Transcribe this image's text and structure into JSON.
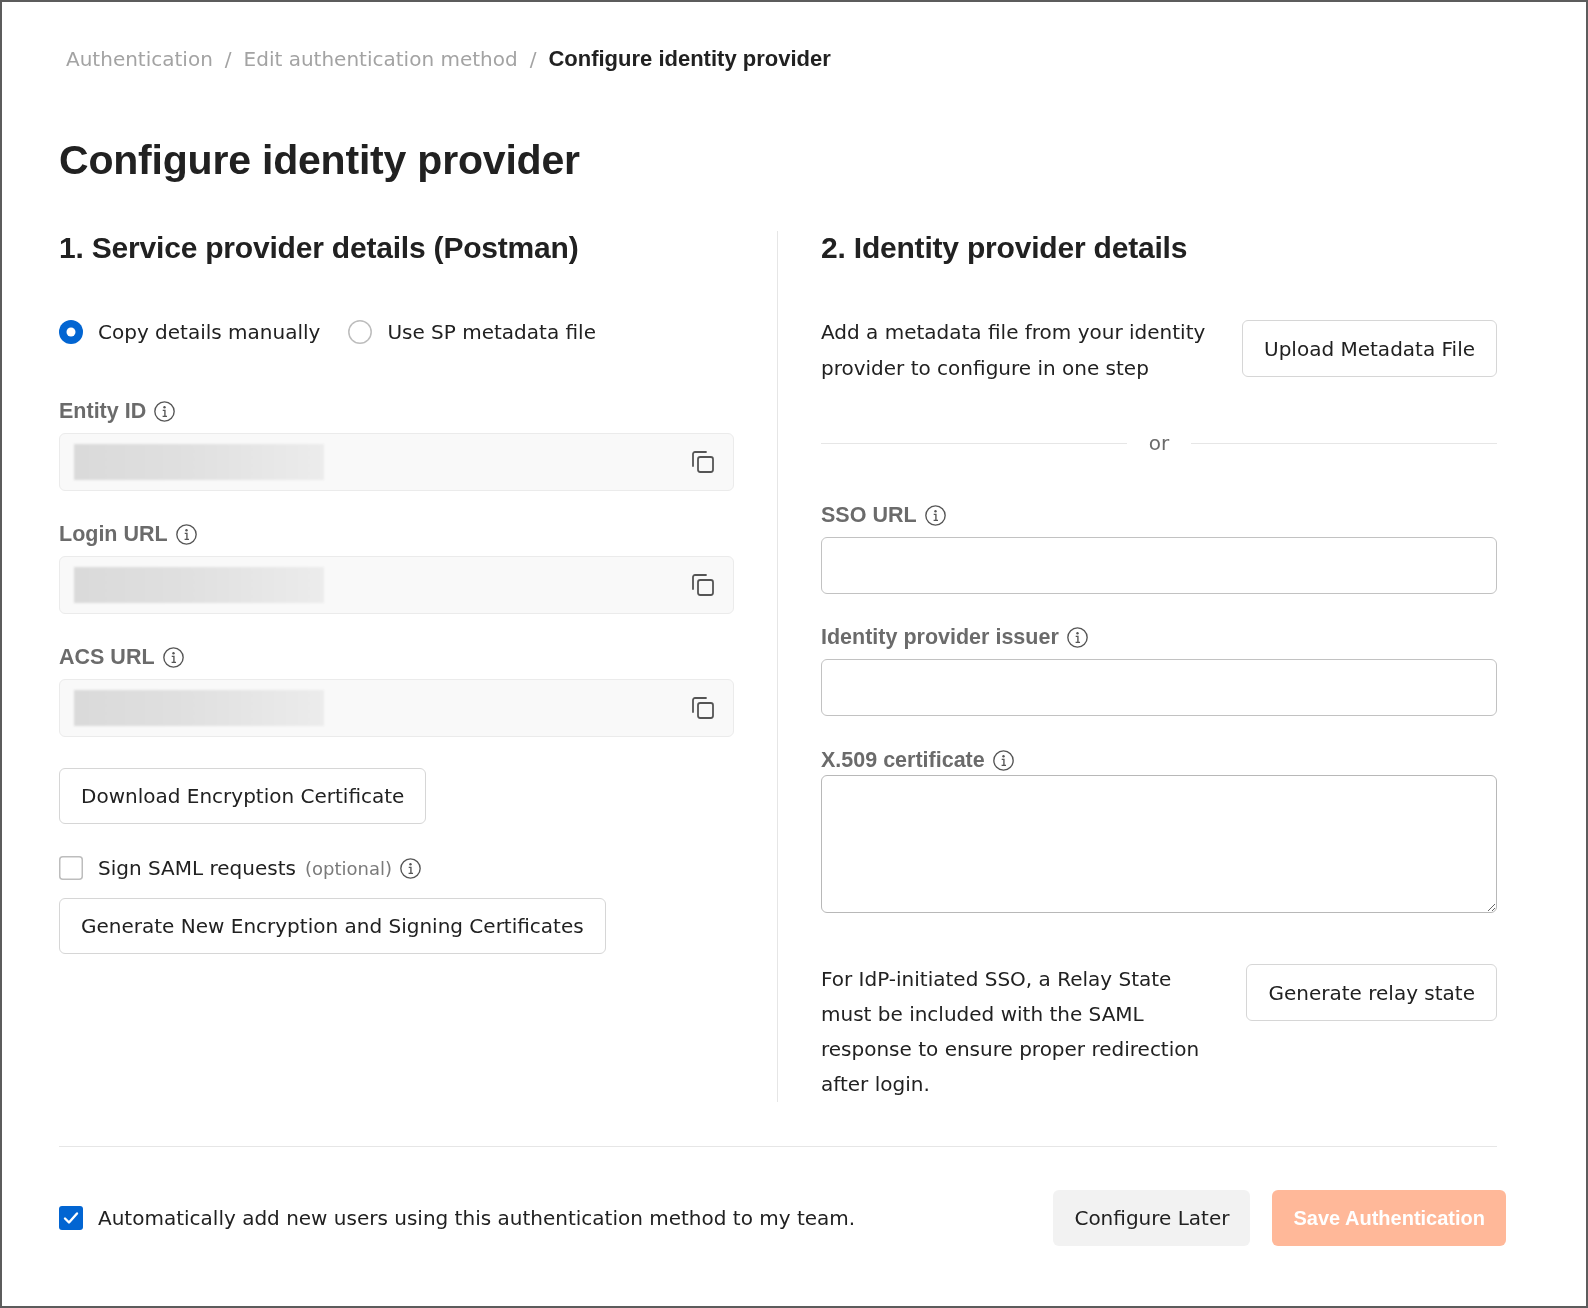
{
  "breadcrumb": [
    {
      "kind": "link",
      "text": "Authentication"
    },
    {
      "kind": "separator",
      "text": "/"
    },
    {
      "kind": "link",
      "text": "Edit authentication method"
    },
    {
      "kind": "separator",
      "text": "/"
    },
    {
      "kind": "current",
      "text": "Configure identity provider"
    }
  ],
  "page_title": "Configure identity provider",
  "service_provider": {
    "heading": "1. Service provider details (Postman)",
    "modes": [
      {
        "label": "Copy details manually",
        "selected": true
      },
      {
        "label": "Use SP metadata file",
        "selected": false
      }
    ],
    "fields": [
      {
        "label": "Entity ID",
        "redacted": true
      },
      {
        "label": "Login URL",
        "redacted": true
      },
      {
        "label": "ACS URL",
        "redacted": true
      }
    ],
    "download_button": "Download Encryption Certificate",
    "sign_requests": {
      "label": "Sign SAML requests",
      "note": "(optional)",
      "checked": false
    },
    "generate_button": "Generate New Encryption and Signing Certificates"
  },
  "identity_provider": {
    "heading": "2. Identity provider details",
    "metadata_hint": "Add a metadata file from your identity provider to configure in one step",
    "upload_button": "Upload Metadata File",
    "separator": "or",
    "fields": [
      {
        "label": "SSO URL",
        "kind": "input"
      },
      {
        "label": "Identity provider issuer",
        "kind": "input"
      },
      {
        "label": "X.509 certificate",
        "kind": "textarea"
      }
    ],
    "relay_hint": "For IdP-initiated SSO, a Relay State must be included with the SAML response to ensure proper redirection after login.",
    "relay_button": "Generate relay state"
  },
  "footer": {
    "auto_add": {
      "label": "Automatically add new users using this authentication method to my team.",
      "checked": true
    },
    "buttons": [
      {
        "label": "Configure Later",
        "kind": "secondary",
        "disabled": false
      },
      {
        "label": "Save Authentication",
        "kind": "primary",
        "disabled": true
      }
    ]
  }
}
